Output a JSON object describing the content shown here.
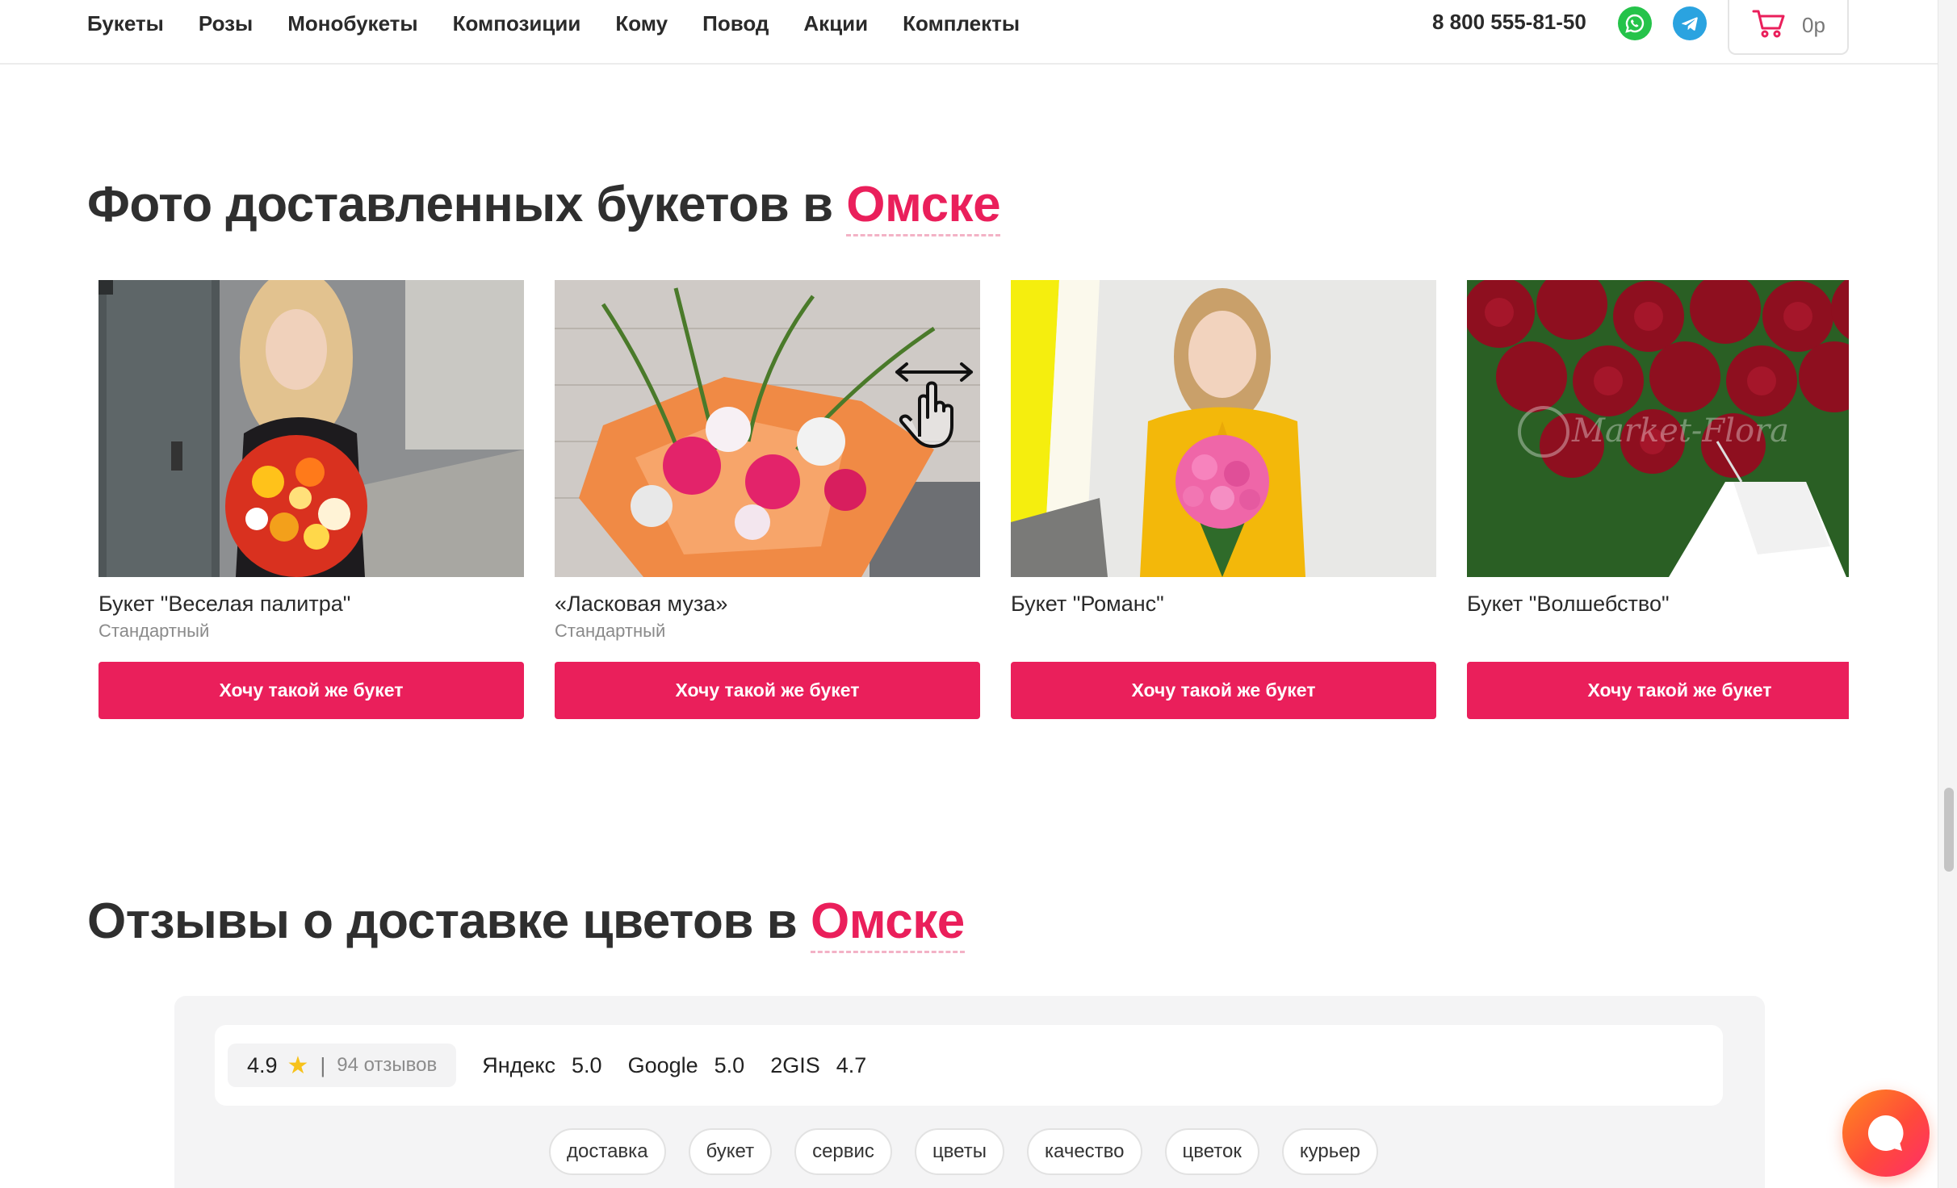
{
  "nav": {
    "items": [
      "Букеты",
      "Розы",
      "Монобукеты",
      "Композиции",
      "Кому",
      "Повод",
      "Акции",
      "Комплекты"
    ]
  },
  "header": {
    "phone": "8 800 555-81-50",
    "cart_total": "0р",
    "icons": [
      "whatsapp-icon",
      "telegram-icon",
      "cart-icon"
    ]
  },
  "photos_section": {
    "title_prefix": "Фото доставленных букетов в",
    "city": "Омске",
    "cards": [
      {
        "title": "Букет \"Веселая палитра\"",
        "subtitle": "Стандартный",
        "button": "Хочу такой же букет"
      },
      {
        "title": "«Ласковая муза»",
        "subtitle": "Стандартный",
        "button": "Хочу такой же букет"
      },
      {
        "title": "Букет \"Романс\"",
        "subtitle": "",
        "button": "Хочу такой же букет"
      },
      {
        "title": "Букет \"Волшебство\"",
        "subtitle": "",
        "button": "Хочу такой же букет"
      }
    ],
    "watermark": "Market-Flora"
  },
  "reviews_section": {
    "title_prefix": "Отзывы о доставке цветов в",
    "city": "Омске",
    "summary": {
      "score": "4.9",
      "separator": "|",
      "count": "94 отзывов"
    },
    "sources": [
      {
        "name": "Яндекс",
        "score": "5.0"
      },
      {
        "name": "Google",
        "score": "5.0"
      },
      {
        "name": "2GIS",
        "score": "4.7"
      }
    ],
    "tags": [
      "доставка",
      "букет",
      "сервис",
      "цветы",
      "качество",
      "цветок",
      "курьер"
    ]
  },
  "colors": {
    "accent": "#ea1f5b",
    "whatsapp": "#25c34a",
    "telegram": "#2aa3e0",
    "star": "#f7c21b"
  }
}
